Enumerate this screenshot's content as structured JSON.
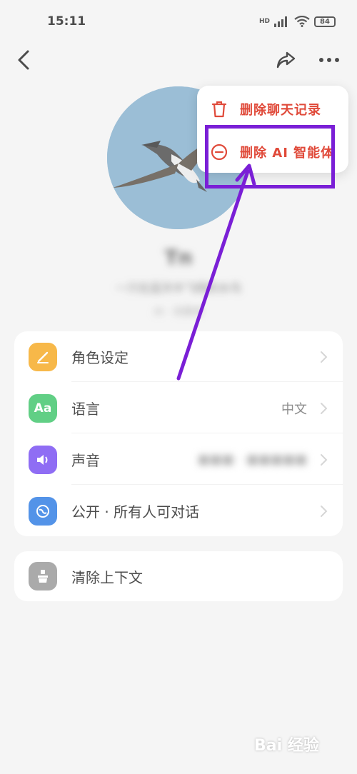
{
  "status_bar": {
    "time": "15:11",
    "network": "HD",
    "battery": "84"
  },
  "bot": {
    "name": "Tn",
    "description": "一只在蓝天中飞翔的水鸟",
    "meta": "AI · 创建者"
  },
  "menu": {
    "items": [
      {
        "label": "删除聊天记录",
        "icon": "trash-icon"
      },
      {
        "label": "删除 AI 智能体",
        "icon": "minus-circle-icon"
      }
    ]
  },
  "settings": {
    "items": [
      {
        "label": "角色设定",
        "value": "",
        "icon": "pen-icon",
        "color": "#f5a10c"
      },
      {
        "label": "语言",
        "value": "中文",
        "icon": "Aa",
        "color": "#2dbf5c"
      },
      {
        "label": "声音",
        "value": "",
        "icon": "speaker-icon",
        "color": "#6a3df0"
      },
      {
        "label": "公开 · 所有人可对话",
        "value": "",
        "icon": "globe-icon",
        "color": "#1a6fe0"
      }
    ],
    "clear": {
      "label": "清除上下文",
      "icon": "broom-icon",
      "color": "#8e8e8e"
    }
  },
  "annotation": {
    "color": "#7a1fd6"
  },
  "watermark": "Bai 经验"
}
